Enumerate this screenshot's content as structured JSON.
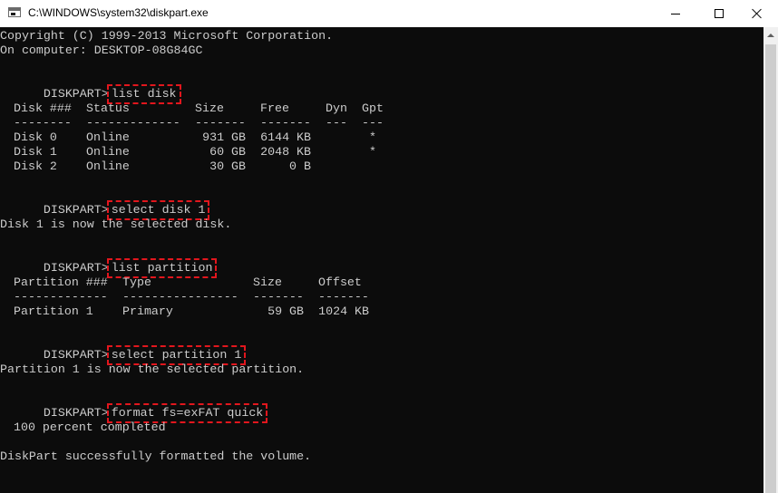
{
  "window": {
    "title": "C:\\WINDOWS\\system32\\diskpart.exe",
    "minimize_icon": "minimize-icon",
    "maximize_icon": "maximize-icon",
    "close_icon": "close-icon"
  },
  "console": {
    "copyright": "Copyright (C) 1999-2013 Microsoft Corporation.",
    "computer": "On computer: DESKTOP-08G84GC",
    "prompt": "DISKPART>",
    "commands": [
      "list disk",
      "select disk 1",
      "list partition",
      "select partition 1",
      "format fs=exFAT quick"
    ],
    "disk_table": {
      "headers": [
        "Disk ###",
        "Status",
        "Size",
        "Free",
        "Dyn",
        "Gpt"
      ],
      "separators": [
        "--------",
        "-------------",
        "-------",
        "-------",
        "---",
        "---"
      ],
      "rows": [
        [
          "Disk 0",
          "Online",
          "931 GB",
          "6144 KB",
          "",
          "*"
        ],
        [
          "Disk 1",
          "Online",
          "60 GB",
          "2048 KB",
          "",
          "*"
        ],
        [
          "Disk 2",
          "Online",
          "30 GB",
          "0 B",
          "",
          ""
        ]
      ]
    },
    "select_disk_msg": "Disk 1 is now the selected disk.",
    "partition_table": {
      "headers": [
        "Partition ###",
        "Type",
        "Size",
        "Offset"
      ],
      "separators": [
        "-------------",
        "----------------",
        "-------",
        "-------"
      ],
      "rows": [
        [
          "Partition 1",
          "Primary",
          "59 GB",
          "1024 KB"
        ]
      ]
    },
    "select_partition_msg": "Partition 1 is now the selected partition.",
    "progress_msg": "100 percent completed",
    "success_msg": "DiskPart successfully formatted the volume."
  },
  "colors": {
    "console_bg": "#0c0c0c",
    "console_text": "#cccccc",
    "highlight": "#e2161d"
  }
}
